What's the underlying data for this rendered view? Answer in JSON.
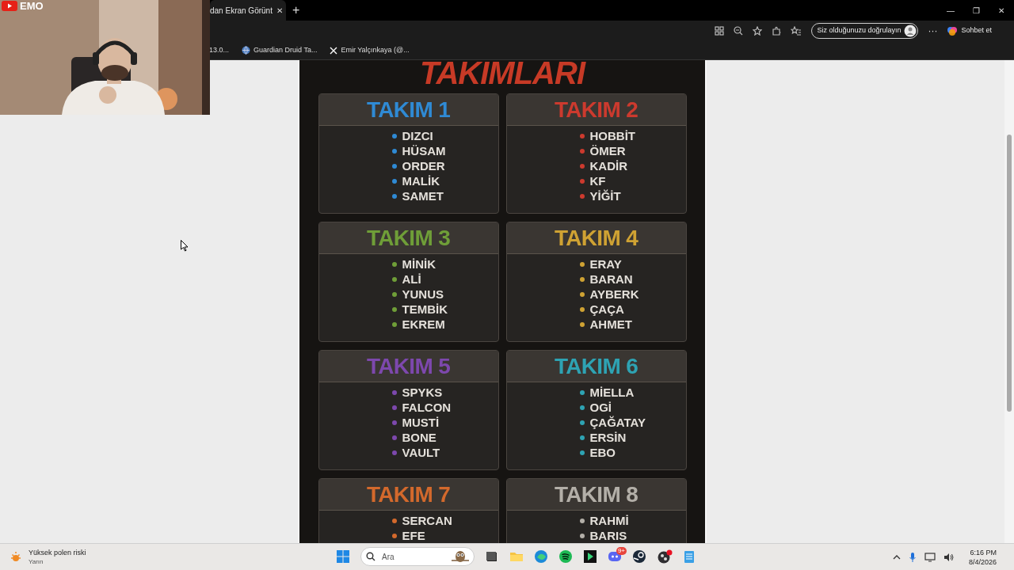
{
  "webcam": {
    "channel": "EMO"
  },
  "browser": {
    "tab": {
      "title": "dan Ekran Görünt",
      "close": "✕"
    },
    "new_tab": "+",
    "window_controls": [
      "—",
      "❐",
      "✕"
    ],
    "verify_button": "Siz olduğunuzu doğrulayın",
    "more_button": "···",
    "chat_button": "Sohbet et",
    "bookmarks": [
      {
        "kind": "plain",
        "label": "13.0..."
      },
      {
        "kind": "globe",
        "label": "Guardian Druid Ta..."
      },
      {
        "kind": "x",
        "label": "Emir Yalçınkaya (@..."
      }
    ]
  },
  "poster": {
    "title": "TAKIMLARI",
    "teams": [
      {
        "name": "TAKIM 1",
        "color": "#2f8ad4",
        "members": [
          "DIZCI",
          "HÜSAM",
          "ORDER",
          "MALİK",
          "SAMET"
        ]
      },
      {
        "name": "TAKIM 2",
        "color": "#cc3a2e",
        "members": [
          "HOBBİT",
          "ÖMER",
          "KADİR",
          "KF",
          "YİĞİT"
        ]
      },
      {
        "name": "TAKIM 3",
        "color": "#6f9e38",
        "members": [
          "MİNİK",
          "ALİ",
          "YUNUS",
          "TEMBİK",
          "EKREM"
        ]
      },
      {
        "name": "TAKIM 4",
        "color": "#cfa233",
        "members": [
          "ERAY",
          "BARAN",
          "AYBERK",
          "ÇAÇA",
          "AHMET"
        ]
      },
      {
        "name": "TAKIM 5",
        "color": "#7d48ad",
        "members": [
          "SPYKS",
          "FALCON",
          "MUSTİ",
          "BONE",
          "VAULT"
        ]
      },
      {
        "name": "TAKIM 6",
        "color": "#2ea3b3",
        "members": [
          "MİELLA",
          "OGİ",
          "ÇAĞATAY",
          "ERSİN",
          "EBO"
        ]
      },
      {
        "name": "TAKIM 7",
        "color": "#d3692c",
        "members": [
          "SERCAN",
          "EFE"
        ]
      },
      {
        "name": "TAKIM 8",
        "color": "#b3afa8",
        "members": [
          "RAHMİ",
          "BARIS"
        ]
      }
    ]
  },
  "taskbar": {
    "weather": {
      "title": "Yüksek polen riski",
      "subtitle": "Yarın"
    },
    "search": {
      "placeholder": "Ara"
    },
    "discord_badge": "9+",
    "clock": {
      "time": "6:16 PM",
      "date": "8/4/2026"
    }
  }
}
